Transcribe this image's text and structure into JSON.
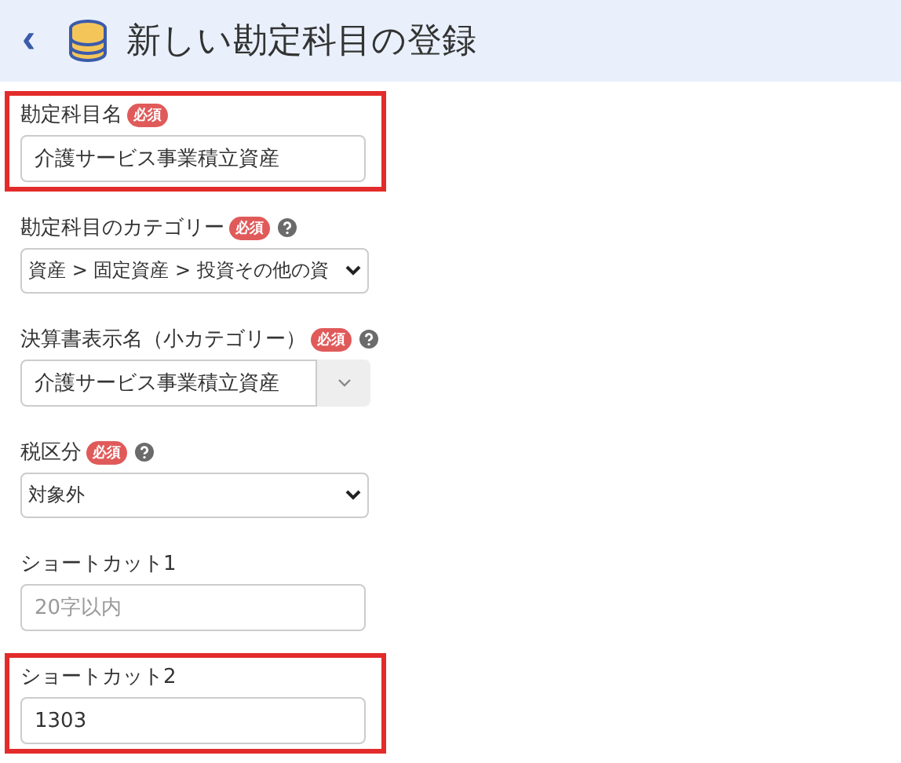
{
  "header": {
    "back": "‹",
    "title": "新しい勘定科目の登録"
  },
  "fields": [
    {
      "kind": "text",
      "label": "勘定科目名",
      "required": "必須",
      "help": false,
      "highlighted": true,
      "value": "介護サービス事業積立資産"
    },
    {
      "kind": "select",
      "label": "勘定科目のカテゴリー",
      "required": "必須",
      "help": true,
      "highlighted": false,
      "value": "資産 > 固定資産 > 投資その他の資"
    },
    {
      "kind": "combo",
      "label": "決算書表示名（小カテゴリー）",
      "required": "必須",
      "help": true,
      "highlighted": false,
      "value": "介護サービス事業積立資産"
    },
    {
      "kind": "select",
      "label": "税区分",
      "required": "必須",
      "help": true,
      "highlighted": false,
      "value": "対象外"
    },
    {
      "kind": "text",
      "label": "ショートカット1",
      "help": false,
      "highlighted": false,
      "placeholder": "20字以内"
    },
    {
      "kind": "text",
      "label": "ショートカット2",
      "help": false,
      "highlighted": true,
      "value": "1303"
    }
  ]
}
